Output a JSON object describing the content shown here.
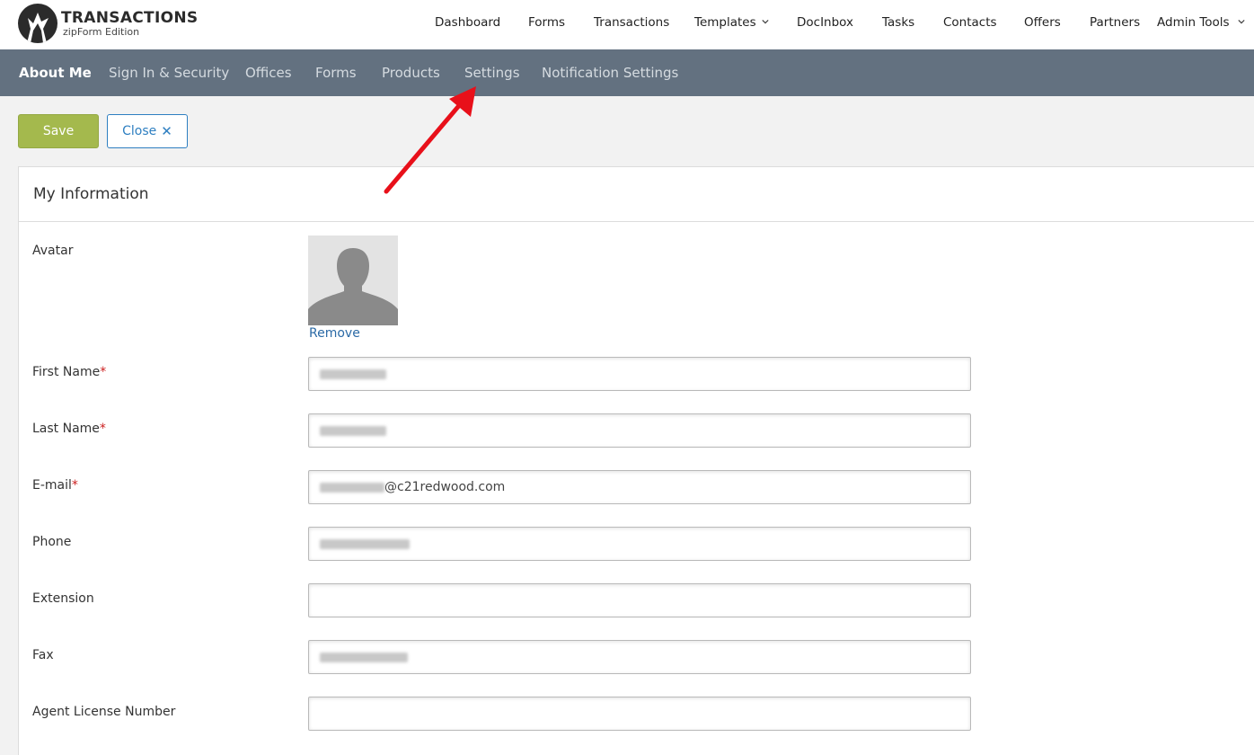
{
  "brand": {
    "title": "TRANSACTIONS",
    "subtitle": "zipForm Edition"
  },
  "topnav": {
    "items": [
      {
        "label": "Dashboard"
      },
      {
        "label": "Forms"
      },
      {
        "label": "Transactions"
      },
      {
        "label": "Templates"
      },
      {
        "label": "DocInbox"
      },
      {
        "label": "Tasks"
      },
      {
        "label": "Contacts"
      },
      {
        "label": "Offers"
      },
      {
        "label": "Partners"
      },
      {
        "label": "Admin Tools"
      }
    ]
  },
  "subnav": {
    "items": [
      {
        "label": "About Me",
        "active": true
      },
      {
        "label": "Sign In & Security"
      },
      {
        "label": "Offices"
      },
      {
        "label": "Forms"
      },
      {
        "label": "Products"
      },
      {
        "label": "Settings"
      },
      {
        "label": "Notification Settings"
      }
    ]
  },
  "toolbar": {
    "save_label": "Save",
    "close_label": "Close",
    "close_icon": "✕"
  },
  "panel": {
    "title": "My Information"
  },
  "form": {
    "avatar_label": "Avatar",
    "remove_label": "Remove",
    "fields": [
      {
        "label": "First Name",
        "required": true,
        "value": ""
      },
      {
        "label": "Last Name",
        "required": true,
        "value": ""
      },
      {
        "label": "E-mail",
        "required": true,
        "value": "@c21redwood.com"
      },
      {
        "label": "Phone",
        "required": false,
        "value": ""
      },
      {
        "label": "Extension",
        "required": false,
        "value": ""
      },
      {
        "label": "Fax",
        "required": false,
        "value": ""
      },
      {
        "label": "Agent License Number",
        "required": false,
        "value": ""
      }
    ],
    "required_marker": "*"
  },
  "colors": {
    "subnav_bg": "#637180",
    "save_bg": "#a4b94d",
    "close_accent": "#2e7fc1",
    "arrow": "#e8101a"
  },
  "icons": [
    "wolf-logo-icon",
    "chevron-down-icon",
    "close-icon",
    "avatar-placeholder-icon",
    "red-arrow-annotation"
  ]
}
